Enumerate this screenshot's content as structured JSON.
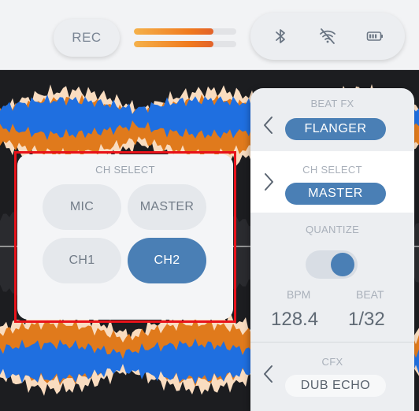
{
  "topbar": {
    "rec_label": "REC",
    "meters": [
      0.78,
      0.78
    ],
    "status_icons": [
      "bluetooth-icon",
      "wifi-off-icon",
      "battery-icon"
    ]
  },
  "fx_panel": {
    "beat_fx": {
      "label": "BEAT FX",
      "value": "FLANGER"
    },
    "ch_select": {
      "label": "CH SELECT",
      "value": "MASTER"
    },
    "quantize": {
      "label": "QUANTIZE",
      "on": true
    },
    "bpm": {
      "label": "BPM",
      "value": "128.4"
    },
    "beat": {
      "label": "BEAT",
      "value": "1/32"
    },
    "cfx": {
      "label": "CFX",
      "value": "DUB ECHO"
    }
  },
  "popup": {
    "title": "CH SELECT",
    "buttons": [
      {
        "label": "MIC",
        "selected": false
      },
      {
        "label": "MASTER",
        "selected": false
      },
      {
        "label": "CH1",
        "selected": false
      },
      {
        "label": "CH2",
        "selected": true
      }
    ]
  },
  "colors": {
    "accent": "#4a7fb5",
    "wave_blue": "#1f6fe0",
    "wave_orange": "#e07a1c",
    "wave_cream": "#f9dcc0",
    "highlight_frame": "#e8121a"
  }
}
